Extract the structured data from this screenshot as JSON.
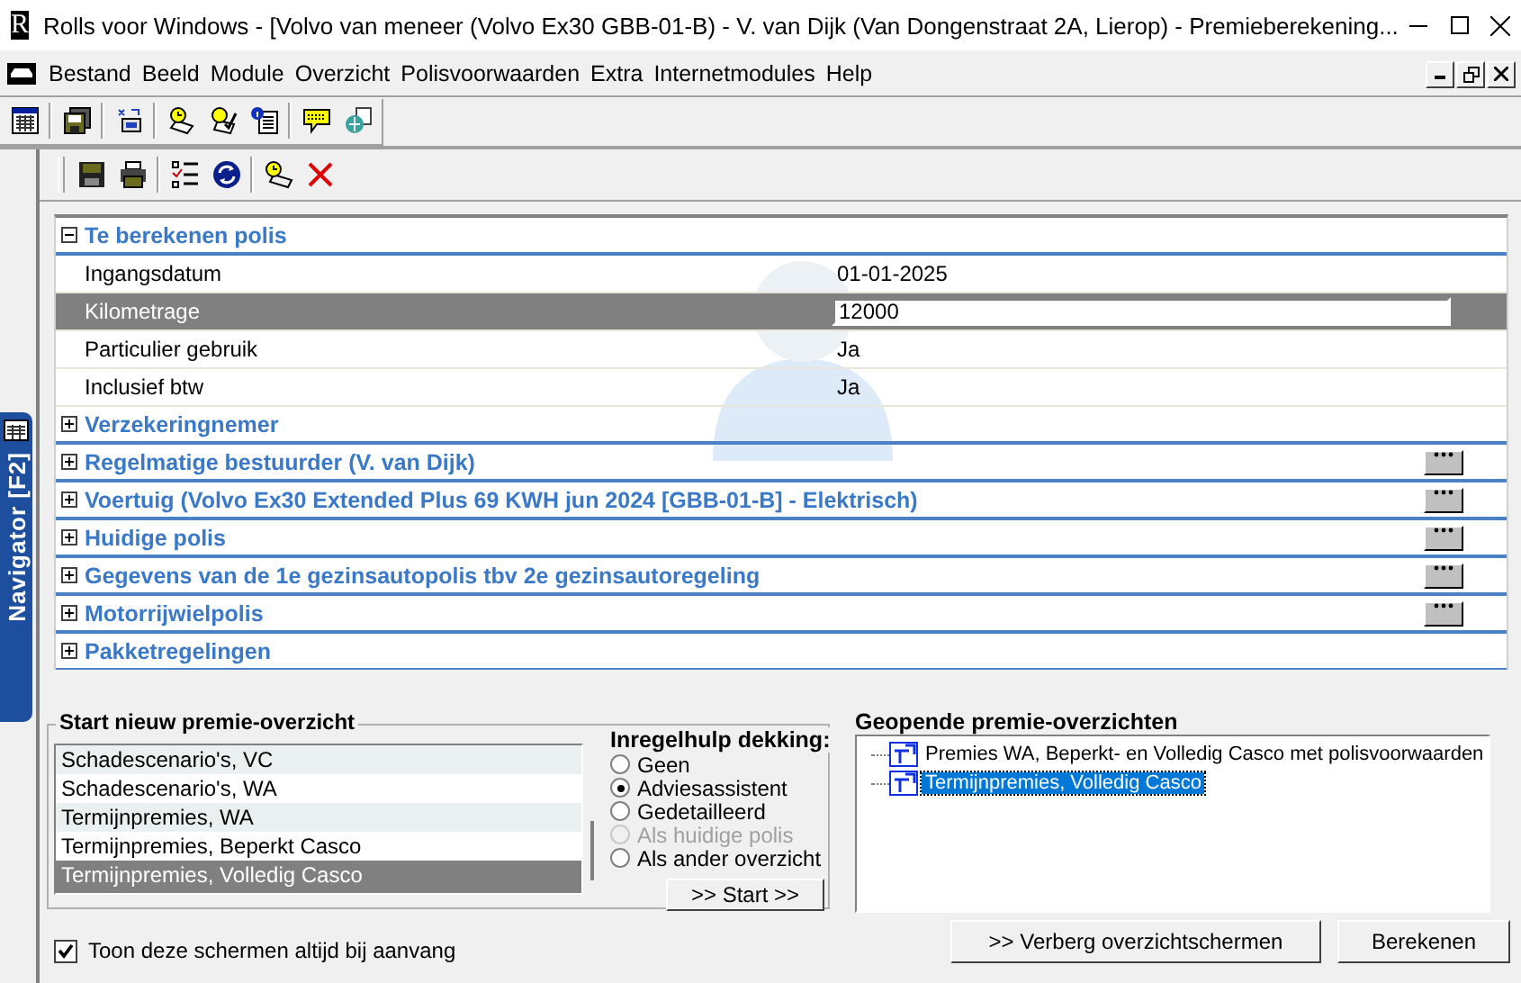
{
  "window": {
    "logo": "R",
    "title": "Rolls voor Windows - [Volvo van meneer (Volvo Ex30 GBB-01-B) - V. van Dijk (Van Dongenstraat 2A, Lierop) - Premieberekening..."
  },
  "menu": [
    "Bestand",
    "Beeld",
    "Module",
    "Overzicht",
    "Polisvoorwaarden",
    "Extra",
    "Internetmodules",
    "Help"
  ],
  "navigator": {
    "label": "Navigator [F2]"
  },
  "policy_panel": {
    "sections": [
      {
        "title": "Te berekenen polis",
        "expanded": true,
        "has_details_button": false,
        "fields": [
          {
            "label": "Ingangsdatum",
            "value": "01-01-2025",
            "kind": "text",
            "selected": false
          },
          {
            "label": "Kilometrage",
            "value": "12000",
            "kind": "input",
            "selected": true
          },
          {
            "label": "Particulier gebruik",
            "value": "Ja",
            "kind": "text",
            "selected": false
          },
          {
            "label": "Inclusief btw",
            "value": "Ja",
            "kind": "text",
            "selected": false
          }
        ]
      },
      {
        "title": "Verzekeringnemer",
        "expanded": false,
        "has_details_button": false
      },
      {
        "title": "Regelmatige bestuurder (V. van Dijk)",
        "expanded": false,
        "has_details_button": true
      },
      {
        "title": "Voertuig (Volvo Ex30 Extended Plus 69 KWH jun 2024 [GBB-01-B] - Elektrisch)",
        "expanded": false,
        "has_details_button": true
      },
      {
        "title": "Huidige polis",
        "expanded": false,
        "has_details_button": true
      },
      {
        "title": "Gegevens van de 1e gezinsautopolis tbv 2e gezinsautoregeling",
        "expanded": false,
        "has_details_button": true
      },
      {
        "title": "Motorrijwielpolis",
        "expanded": false,
        "has_details_button": true
      },
      {
        "title": "Pakketregelingen",
        "expanded": false,
        "has_details_button": false
      }
    ]
  },
  "new_overview": {
    "title": "Start nieuw premie-overzicht",
    "items": [
      {
        "label": "Schadescenario's,  VC",
        "selected": false
      },
      {
        "label": "Schadescenario's,  WA",
        "selected": false
      },
      {
        "label": "Termijnpremies,  WA",
        "selected": false
      },
      {
        "label": "Termijnpremies, Beperkt Casco",
        "selected": false
      },
      {
        "label": "Termijnpremies, Volledig Casco",
        "selected": true
      }
    ],
    "assist": {
      "title": "Inregelhulp dekking:",
      "options": [
        {
          "label": "Geen",
          "selected": false,
          "disabled": false
        },
        {
          "label": "Adviesassistent",
          "selected": true,
          "disabled": false
        },
        {
          "label": "Gedetailleerd",
          "selected": false,
          "disabled": false
        },
        {
          "label": "Als huidige polis",
          "selected": false,
          "disabled": true
        },
        {
          "label": "Als ander overzicht",
          "selected": false,
          "disabled": false
        }
      ]
    },
    "start_button": ">> Start >>"
  },
  "open_overviews": {
    "title": "Geopende premie-overzichten",
    "items": [
      {
        "label": "Premies WA, Beperkt- en Volledig Casco met polisvoorwaarden",
        "selected": false
      },
      {
        "label": "Termijnpremies, Volledig Casco",
        "selected": true
      }
    ]
  },
  "show_on_start": {
    "label": "Toon deze schermen altijd bij aanvang",
    "checked": true
  },
  "buttons": [
    ">> Verberg overzichtschermen",
    "Berekenen"
  ]
}
